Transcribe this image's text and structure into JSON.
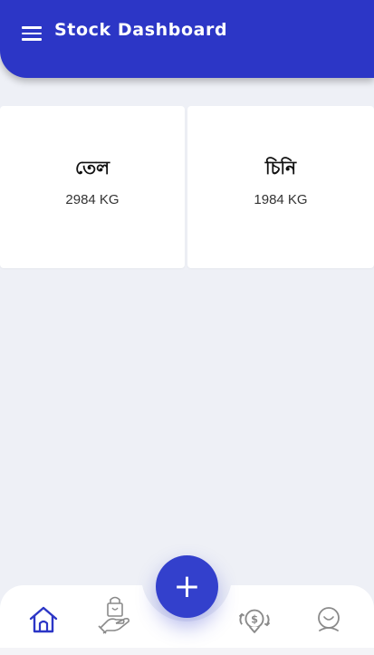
{
  "header": {
    "title": "Stock Dashboard",
    "menu_icon": "menu-icon"
  },
  "stock_items": [
    {
      "name": "তেল",
      "quantity": "2984 KG"
    },
    {
      "name": "চিনি",
      "quantity": "1984 KG"
    }
  ],
  "fab": {
    "label": "+",
    "icon": "plus-icon"
  },
  "bottom_nav": {
    "items": [
      {
        "icon": "home-icon",
        "active": true
      },
      {
        "icon": "hand-bag-icon",
        "active": false
      },
      {
        "icon": "money-exchange-icon",
        "active": false
      },
      {
        "icon": "user-icon",
        "active": false
      }
    ]
  },
  "colors": {
    "primary": "#2c36c6",
    "background": "#eef0f6",
    "card": "#ffffff",
    "nav_active": "#2c36c6",
    "nav_inactive": "#8a8a8a"
  }
}
